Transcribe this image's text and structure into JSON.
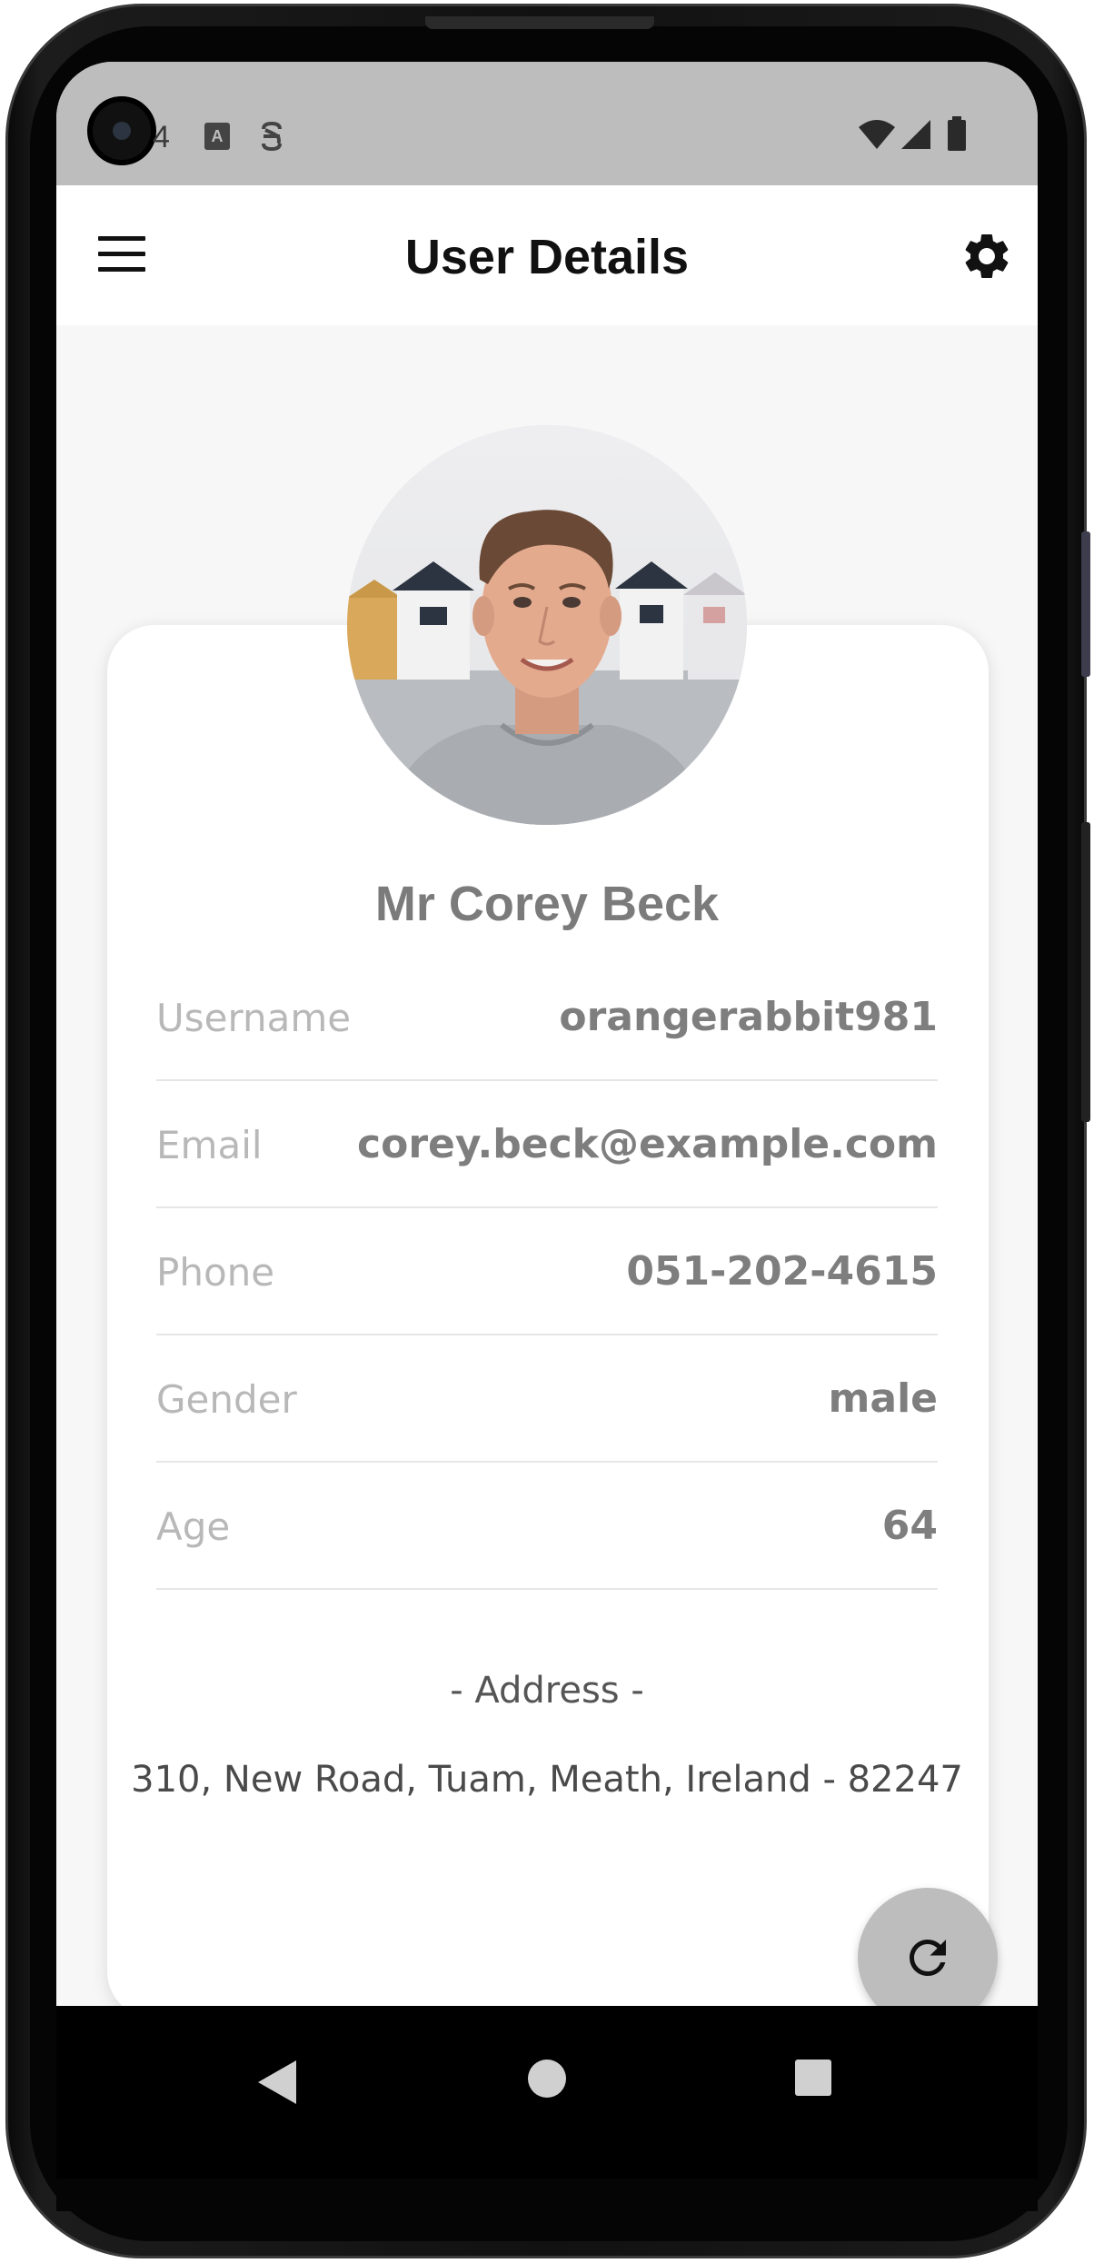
{
  "status_bar": {
    "time": "4",
    "icons": [
      "notification-a-icon",
      "notification-s-icon",
      "wifi-icon",
      "signal-icon",
      "battery-icon"
    ]
  },
  "app_bar": {
    "title": "User Details",
    "menu_icon": "hamburger-menu-icon",
    "settings_icon": "gear-icon"
  },
  "profile": {
    "name": "Mr Corey Beck",
    "avatar": "profile-photo"
  },
  "details": [
    {
      "label": "Username",
      "value": "orangerabbit981"
    },
    {
      "label": "Email",
      "value": "corey.beck@example.com"
    },
    {
      "label": "Phone",
      "value": "051-202-4615"
    },
    {
      "label": "Gender",
      "value": "male"
    },
    {
      "label": "Age",
      "value": "64"
    }
  ],
  "address": {
    "title": "- Address -",
    "text": "310, New Road, Tuam, Meath, Ireland - 82247"
  },
  "fab": {
    "icon": "refresh-icon"
  },
  "nav_bar": {
    "icons": [
      "back-icon",
      "home-icon",
      "recents-icon"
    ]
  },
  "colors": {
    "status_bar": "#bdbdbd",
    "app_bar": "#ffffff",
    "background": "#f7f7f7",
    "card": "#ffffff",
    "label": "#b8b8b8",
    "value": "#7e7e7e",
    "fab": "#bdbdbd"
  }
}
